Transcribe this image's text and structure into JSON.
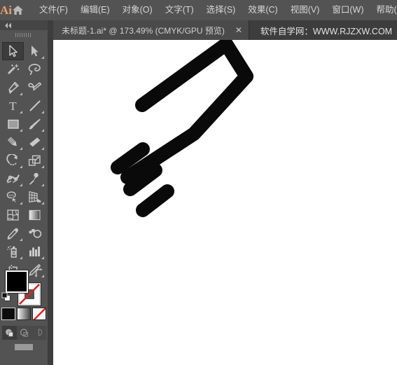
{
  "app": {
    "name": "Ai",
    "logo_color": "#e8a06a",
    "chrome_bg": "#535353",
    "tabbar_bg": "#3d3d3d",
    "canvas_bg": "#ffffff"
  },
  "menubar": {
    "logo_label": "Ai",
    "home_icon": "home-icon",
    "items": [
      {
        "label": "文件(F)"
      },
      {
        "label": "编辑(E)"
      },
      {
        "label": "对象(O)"
      },
      {
        "label": "文字(T)"
      },
      {
        "label": "选择(S)"
      },
      {
        "label": "效果(C)"
      },
      {
        "label": "视图(V)"
      },
      {
        "label": "窗口(W)"
      },
      {
        "label": "帮助(H"
      }
    ]
  },
  "tabbar": {
    "document_tab": {
      "label": "未标题-1.ai* @ 173.49% (CMYK/GPU 预览)",
      "close_glyph": "✕",
      "modified": true,
      "zoom_level": "173.49%",
      "color_mode": "CMYK/GPU 预览"
    },
    "watermark": "软件自学网：WWW.RJZXW.COM"
  },
  "toolpanel": {
    "collapse_glyph": "◂◂",
    "grip": "drag-grip",
    "tools": [
      {
        "name": "selection-tool",
        "active": true,
        "corner": false
      },
      {
        "name": "direct-selection-tool",
        "active": false,
        "corner": true
      },
      {
        "name": "magic-wand-tool",
        "active": false,
        "corner": false
      },
      {
        "name": "lasso-tool",
        "active": false,
        "corner": false
      },
      {
        "name": "pen-tool",
        "active": false,
        "corner": true
      },
      {
        "name": "curvature-tool",
        "active": false,
        "corner": false
      },
      {
        "name": "type-tool",
        "active": false,
        "corner": true
      },
      {
        "name": "line-segment-tool",
        "active": false,
        "corner": true
      },
      {
        "name": "rectangle-tool",
        "active": false,
        "corner": true
      },
      {
        "name": "paintbrush-tool",
        "active": false,
        "corner": true
      },
      {
        "name": "shaper-pencil-tool",
        "active": false,
        "corner": true
      },
      {
        "name": "eraser-tool",
        "active": false,
        "corner": true
      },
      {
        "name": "rotate-tool",
        "active": false,
        "corner": true
      },
      {
        "name": "scale-tool",
        "active": false,
        "corner": true
      },
      {
        "name": "width-warp-tool",
        "active": false,
        "corner": true
      },
      {
        "name": "free-transform-tool",
        "active": false,
        "corner": true
      },
      {
        "name": "shape-builder-tool",
        "active": false,
        "corner": true
      },
      {
        "name": "perspective-grid-tool",
        "active": false,
        "corner": true
      },
      {
        "name": "mesh-tool",
        "active": false,
        "corner": false
      },
      {
        "name": "gradient-tool",
        "active": false,
        "corner": false
      },
      {
        "name": "eyedropper-tool",
        "active": false,
        "corner": true
      },
      {
        "name": "blend-tool",
        "active": false,
        "corner": false
      },
      {
        "name": "symbol-sprayer-tool",
        "active": false,
        "corner": true
      },
      {
        "name": "column-graph-tool",
        "active": false,
        "corner": true
      },
      {
        "name": "artboard-tool",
        "active": false,
        "corner": false
      },
      {
        "name": "slice-tool",
        "active": false,
        "corner": true
      },
      {
        "name": "hand-tool",
        "active": false,
        "corner": true
      },
      {
        "name": "zoom-tool",
        "active": false,
        "corner": false
      }
    ]
  },
  "color_controls": {
    "fill": {
      "name": "fill-swatch",
      "color": "#000000",
      "label": "Fill"
    },
    "stroke": {
      "name": "stroke-swatch",
      "color": "#ffffff",
      "is_none": true,
      "label": "Stroke"
    },
    "swap_icon": "swap-fill-stroke-icon",
    "default_icon": "default-fill-stroke-icon",
    "modes": [
      {
        "name": "color-mode-button",
        "selected": true
      },
      {
        "name": "gradient-mode-button",
        "selected": false
      },
      {
        "name": "none-mode-button",
        "selected": false
      }
    ],
    "draw_modes": [
      {
        "name": "draw-normal-button",
        "selected": true
      },
      {
        "name": "draw-behind-button",
        "selected": false
      },
      {
        "name": "draw-inside-button",
        "selected": false
      }
    ],
    "screen_mode": {
      "name": "screen-mode-button"
    }
  },
  "artwork": {
    "name": "speed-lines-artwork",
    "stroke_color": "#0a0a0a",
    "description": "Rotated open rectangle outline with three parallel motion lines"
  }
}
